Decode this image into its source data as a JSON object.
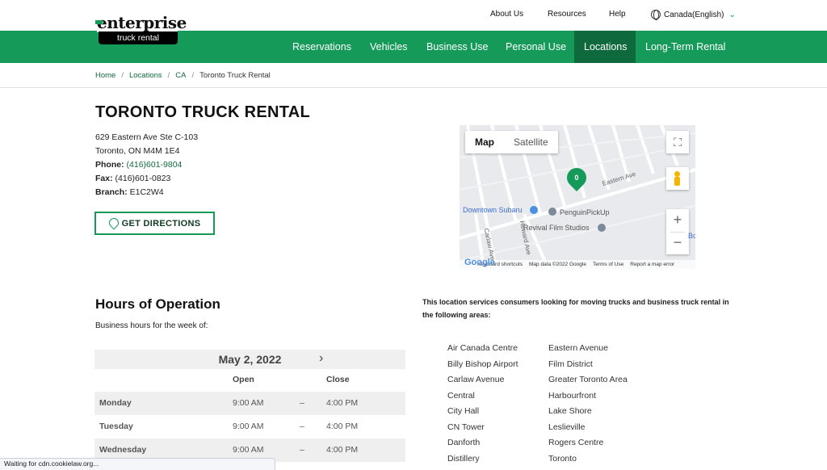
{
  "brand": {
    "wordmark": "enterprise",
    "sub": "truck rental"
  },
  "utility_nav": {
    "about": "About Us",
    "resources": "Resources",
    "help": "Help",
    "country": "Canada(English)"
  },
  "main_nav": [
    "Reservations",
    "Vehicles",
    "Business Use",
    "Personal Use",
    "Locations",
    "Long-Term Rental"
  ],
  "main_nav_active": "Locations",
  "breadcrumb": {
    "home": "Home",
    "locations": "Locations",
    "province": "CA",
    "current": "Toronto Truck Rental"
  },
  "location": {
    "title": "TORONTO TRUCK RENTAL",
    "street": "629 Eastern Ave Ste C-103",
    "city": "Toronto, ON M4M 1E4",
    "phone_label": "Phone:",
    "phone": "(416)601-9804",
    "fax_label": "Fax:",
    "fax": "(416)601-0823",
    "branch_label": "Branch:",
    "branch": "E1C2W4",
    "directions_button": "GET DIRECTIONS"
  },
  "map": {
    "map_tab": "Map",
    "satellite_tab": "Satellite",
    "marker": "0",
    "labels": {
      "eastern_ave": "Eastern Ave",
      "downtown_subaru": "Downtown Subaru",
      "penguin": "PenguinPickUp",
      "revival": "Revival Film Studios",
      "heward": "Heward Ave",
      "carlaw": "Carlaw Ave",
      "edge": "Bc"
    },
    "footer": {
      "shortcuts": "Keyboard shortcuts",
      "data": "Map data ©2022 Google",
      "terms": "Terms of Use",
      "report": "Report a map error"
    },
    "google": "Google"
  },
  "hours": {
    "title": "Hours of Operation",
    "subtitle": "Business hours for the week of:",
    "week": "May 2, 2022",
    "open_header": "Open",
    "close_header": "Close",
    "days": [
      {
        "day": "Monday",
        "open": "9:00 AM",
        "dash": "–",
        "close": "4:00 PM"
      },
      {
        "day": "Tuesday",
        "open": "9:00 AM",
        "dash": "–",
        "close": "4:00 PM"
      },
      {
        "day": "Wednesday",
        "open": "9:00 AM",
        "dash": "–",
        "close": "4:00 PM"
      }
    ]
  },
  "areas": {
    "intro": "This location services consumers looking for moving trucks and business truck rental in the following areas:",
    "col1": [
      "Air Canada Centre",
      "Billy Bishop Airport",
      "Carlaw Avenue",
      "Central",
      "City Hall",
      "CN Tower",
      "Danforth",
      "Distillery"
    ],
    "col2": [
      "Eastern Avenue",
      "Film District",
      "Greater Toronto Area",
      "Harbourfront",
      "Lake Shore",
      "Leslieville",
      "Rogers Centre",
      "Toronto"
    ]
  },
  "status_bar": "Waiting for cdn.cookielaw.org...",
  "colors": {
    "brand_green": "#169a5a",
    "active_nav": "#0e6a3d"
  }
}
